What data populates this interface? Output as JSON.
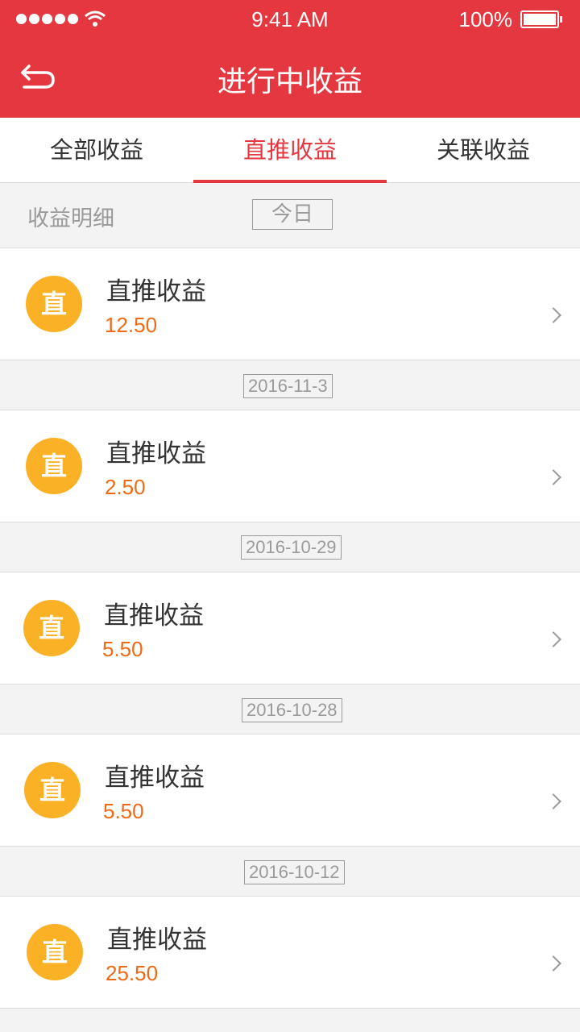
{
  "status_bar": {
    "time": "9:41 AM",
    "battery": "100%"
  },
  "header": {
    "title": "进行中收益",
    "back_icon": "back-arrow-icon"
  },
  "tabs": [
    {
      "label": "全部收益",
      "active": false
    },
    {
      "label": "直推收益",
      "active": true
    },
    {
      "label": "关联收益",
      "active": false
    }
  ],
  "section": {
    "label": "收益明细",
    "date_filter": "今日"
  },
  "items": [
    {
      "badge": "直",
      "title": "直推收益",
      "amount": "12.50"
    },
    {
      "badge": "直",
      "title": "直推收益",
      "amount": "2.50"
    },
    {
      "badge": "直",
      "title": "直推收益",
      "amount": "5.50"
    },
    {
      "badge": "直",
      "title": "直推收益",
      "amount": "5.50"
    },
    {
      "badge": "直",
      "title": "直推收益",
      "amount": "25.50"
    }
  ],
  "date_separators": [
    "2016-11-3",
    "2016-10-29",
    "2016-10-28",
    "2016-10-12"
  ],
  "colors": {
    "accent": "#e5373f",
    "badge": "#fbb126",
    "amount": "#ef6a15"
  }
}
